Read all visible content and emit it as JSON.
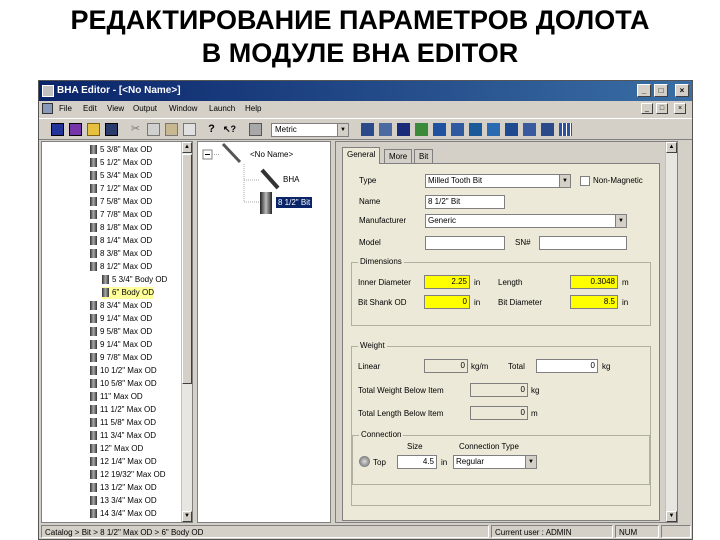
{
  "slide": {
    "title_line1": "РЕДАКТИРОВАНИЕ ПАРАМЕТРОВ ДОЛОТА",
    "title_line2": "В МОДУЛЕ BHA EDITOR"
  },
  "window": {
    "title": "BHA Editor - [<No Name>]",
    "title_buttons": [
      "_",
      "□",
      "×"
    ],
    "mdi_buttons": [
      "_",
      "□",
      "×"
    ]
  },
  "menu": [
    "File",
    "Edit",
    "View",
    "Output",
    "Window",
    "Launch",
    "Help"
  ],
  "toolbar": {
    "unit_select": "Metric"
  },
  "catalog": {
    "items": [
      {
        "label": "5 3/8\" Max OD",
        "indent": 0
      },
      {
        "label": "5 1/2\" Max OD",
        "indent": 0
      },
      {
        "label": "5 3/4\" Max OD",
        "indent": 0
      },
      {
        "label": "7 1/2\" Max OD",
        "indent": 0
      },
      {
        "label": "7 5/8\" Max OD",
        "indent": 0
      },
      {
        "label": "7 7/8\" Max OD",
        "indent": 0
      },
      {
        "label": "8 1/8\" Max OD",
        "indent": 0
      },
      {
        "label": "8 1/4\" Max OD",
        "indent": 0
      },
      {
        "label": "8 3/8\" Max OD",
        "indent": 0
      },
      {
        "label": "8 1/2\" Max OD",
        "indent": 0
      },
      {
        "label": "5 3/4\" Body OD",
        "indent": 1
      },
      {
        "label": "6\" Body OD",
        "indent": 1
      },
      {
        "label": "8 3/4\" Max OD",
        "indent": 0
      },
      {
        "label": "9 1/4\" Max OD",
        "indent": 0
      },
      {
        "label": "9 5/8\" Max OD",
        "indent": 0
      },
      {
        "label": "9 1/4\" Max OD",
        "indent": 0
      },
      {
        "label": "9 7/8\" Max OD",
        "indent": 0
      },
      {
        "label": "10 1/2\" Max OD",
        "indent": 0
      },
      {
        "label": "10 5/8\" Max OD",
        "indent": 0
      },
      {
        "label": "11\" Max OD",
        "indent": 0
      },
      {
        "label": "11 1/2\" Max OD",
        "indent": 0
      },
      {
        "label": "11 5/8\" Max OD",
        "indent": 0
      },
      {
        "label": "11 3/4\" Max OD",
        "indent": 0
      },
      {
        "label": "12\" Max OD",
        "indent": 0
      },
      {
        "label": "12 1/4\" Max OD",
        "indent": 0
      },
      {
        "label": "12 19/32\" Max OD",
        "indent": 0
      },
      {
        "label": "13 1/2\" Max OD",
        "indent": 0
      },
      {
        "label": "13 3/4\" Max OD",
        "indent": 0
      },
      {
        "label": "14 3/4\" Max OD",
        "indent": 0
      }
    ]
  },
  "bha_tree": {
    "root": "<No Name>",
    "bha": "BHA",
    "bit": "8 1/2\" Bit"
  },
  "tabs": [
    "General",
    "More",
    "Bit"
  ],
  "general": {
    "type_label": "Type",
    "type_value": "Milled Tooth Bit",
    "nonmag_label": "Non-Magnetic",
    "name_label": "Name",
    "name_value": "8 1/2\" Bit",
    "manufacturer_label": "Manufacturer",
    "manufacturer_value": "Generic",
    "model_label": "Model",
    "model_value": "",
    "sn_label": "SN#",
    "sn_value": "",
    "dimensions": {
      "group": "Dimensions",
      "inner_diameter_label": "Inner Diameter",
      "inner_diameter_value": "2.25",
      "inner_diameter_unit": "in",
      "length_label": "Length",
      "length_value": "0.3048",
      "length_unit": "m",
      "bit_shank_od_label": "Bit Shank OD",
      "bit_shank_od_value": "0",
      "bit_shank_od_unit": "in",
      "bit_diameter_label": "Bit Diameter",
      "bit_diameter_value": "8.5",
      "bit_diameter_unit": "in"
    },
    "weight": {
      "group": "Weight",
      "linear_label": "Linear",
      "linear_value": "0",
      "linear_unit": "kg/m",
      "total_label": "Total",
      "total_value": "0",
      "total_unit": "kg",
      "total_weight_below_label": "Total Weight Below Item",
      "total_weight_below_value": "0",
      "total_weight_below_unit": "kg",
      "total_length_below_label": "Total Length Below Item",
      "total_length_below_value": "0",
      "total_length_below_unit": "m"
    },
    "connection": {
      "group": "Connection",
      "size_header": "Size",
      "type_header": "Connection Type",
      "top_label": "Top",
      "top_size": "4.5",
      "top_unit": "in",
      "top_type": "Regular"
    }
  },
  "status": {
    "path": "Catalog > Bit > 8 1/2\" Max OD > 6\" Body OD",
    "user": "Current user : ADMIN",
    "num": "NUM"
  },
  "colors": {
    "titlebar_start": "#0a246a",
    "titlebar_end": "#3a6ea5",
    "highlight_field": "#ffff00",
    "selection": "#0a246a"
  }
}
